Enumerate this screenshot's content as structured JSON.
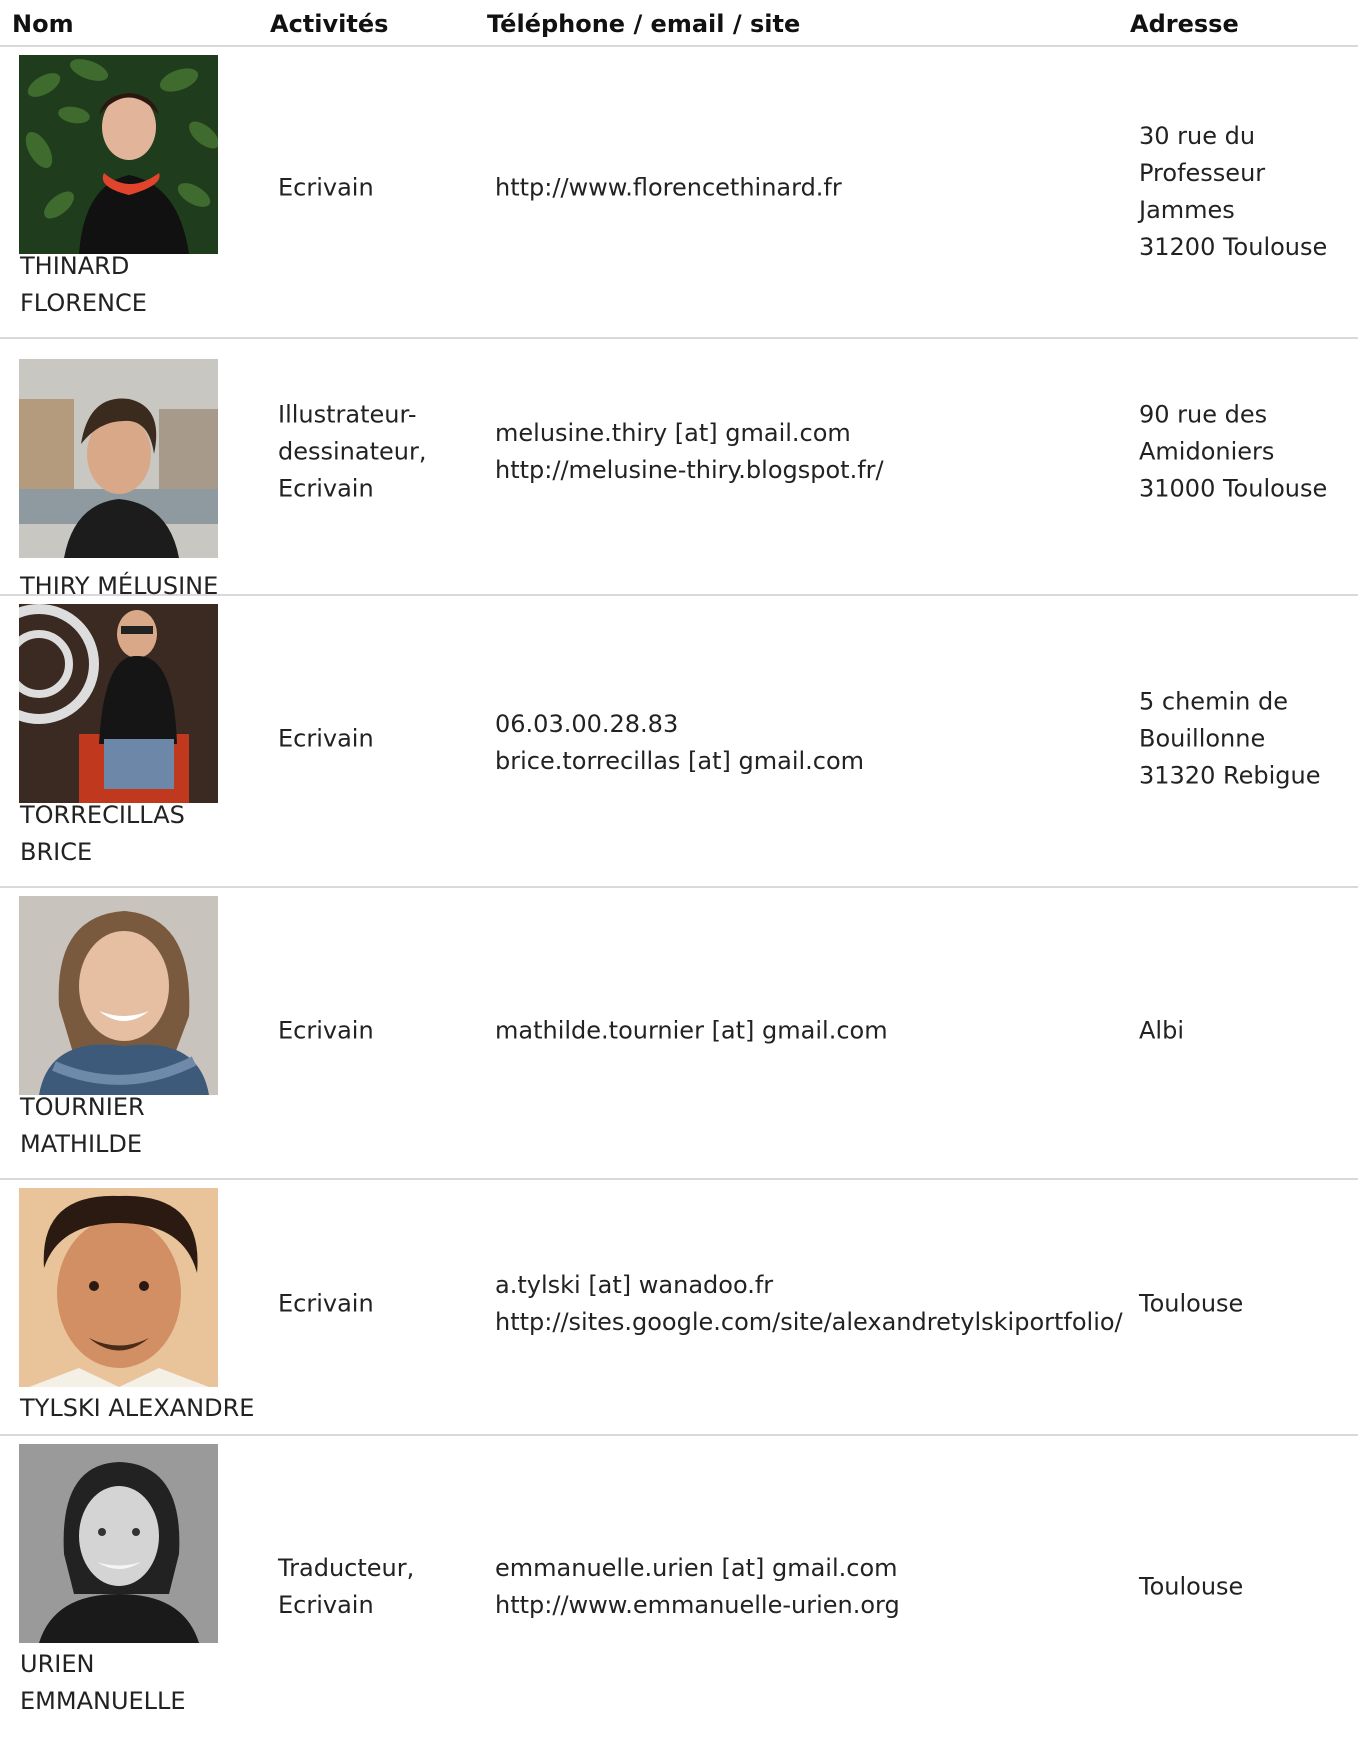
{
  "headers": {
    "nom": "Nom",
    "activites": "Activités",
    "contact": "Téléphone / email / site",
    "adresse": "Adresse"
  },
  "rows": [
    {
      "name": "THINARD\nFLORENCE",
      "activity": "Ecrivain",
      "contact": "http://www.florencethinard.fr",
      "address": "30 rue du\nProfesseur\nJammes\n31200 Toulouse"
    },
    {
      "name": "THIRY MÉLUSINE",
      "activity": "Illustrateur-\ndessinateur,\nEcrivain",
      "contact": "melusine.thiry [at] gmail.com\nhttp://melusine-thiry.blogspot.fr/",
      "address": "90 rue des\nAmidoniers\n31000 Toulouse"
    },
    {
      "name": "TORRECILLAS\nBRICE",
      "activity": "Ecrivain",
      "contact": "06.03.00.28.83\nbrice.torrecillas [at] gmail.com",
      "address": "5 chemin de\nBouillonne\n31320 Rebigue"
    },
    {
      "name": "TOURNIER\nMATHILDE",
      "activity": "Ecrivain",
      "contact": "mathilde.tournier [at] gmail.com",
      "address": "Albi"
    },
    {
      "name": "TYLSKI ALEXANDRE",
      "activity": "Ecrivain",
      "contact": "a.tylski [at] wanadoo.fr\nhttp://sites.google.com/site/alexandretylskiportfolio/",
      "address": "Toulouse"
    },
    {
      "name": "URIEN\nEMMANUELLE",
      "activity": "Traducteur,\nEcrivain",
      "contact": "emmanuelle.urien [at] gmail.com\nhttp://www.emmanuelle-urien.org",
      "address": "Toulouse"
    }
  ]
}
